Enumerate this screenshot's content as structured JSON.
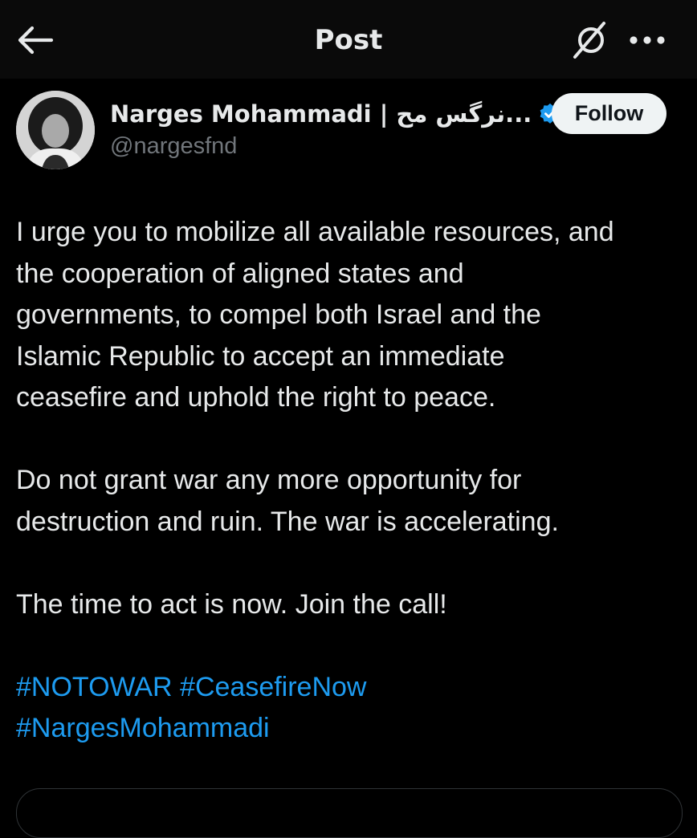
{
  "header": {
    "title": "Post",
    "back_icon": "arrow-left-icon",
    "grok_icon": "grok-icon",
    "more_icon": "more-horizontal-icon"
  },
  "author": {
    "name": "Narges Mohammadi | نرگس مح...",
    "handle": "@nargesfnd",
    "verified_icon": "verified-badge-icon",
    "verified_color": "#1d9bf0"
  },
  "follow_button": {
    "label": "Follow"
  },
  "tweet": {
    "paragraphs": [
      {
        "lines": [
          "I urge you to mobilize all available resources, and",
          "the cooperation of aligned states and",
          "governments, to compel both Israel and the",
          "Islamic Republic to accept an immediate",
          "ceasefire and uphold the right to peace."
        ]
      },
      {
        "lines": [
          "Do not grant war any more opportunity for",
          "destruction and ruin. The war is accelerating."
        ]
      },
      {
        "lines": [
          "The time to act is now. Join the call!"
        ]
      }
    ],
    "hashtags": [
      "#NOTOWAR",
      "#CeasefireNow",
      "#NargesMohammadi"
    ],
    "hashtag_color": "#1d9bf0"
  },
  "colors": {
    "background": "#000000",
    "text": "#e7e9ea",
    "muted": "#71767b",
    "accent": "#1d9bf0"
  }
}
